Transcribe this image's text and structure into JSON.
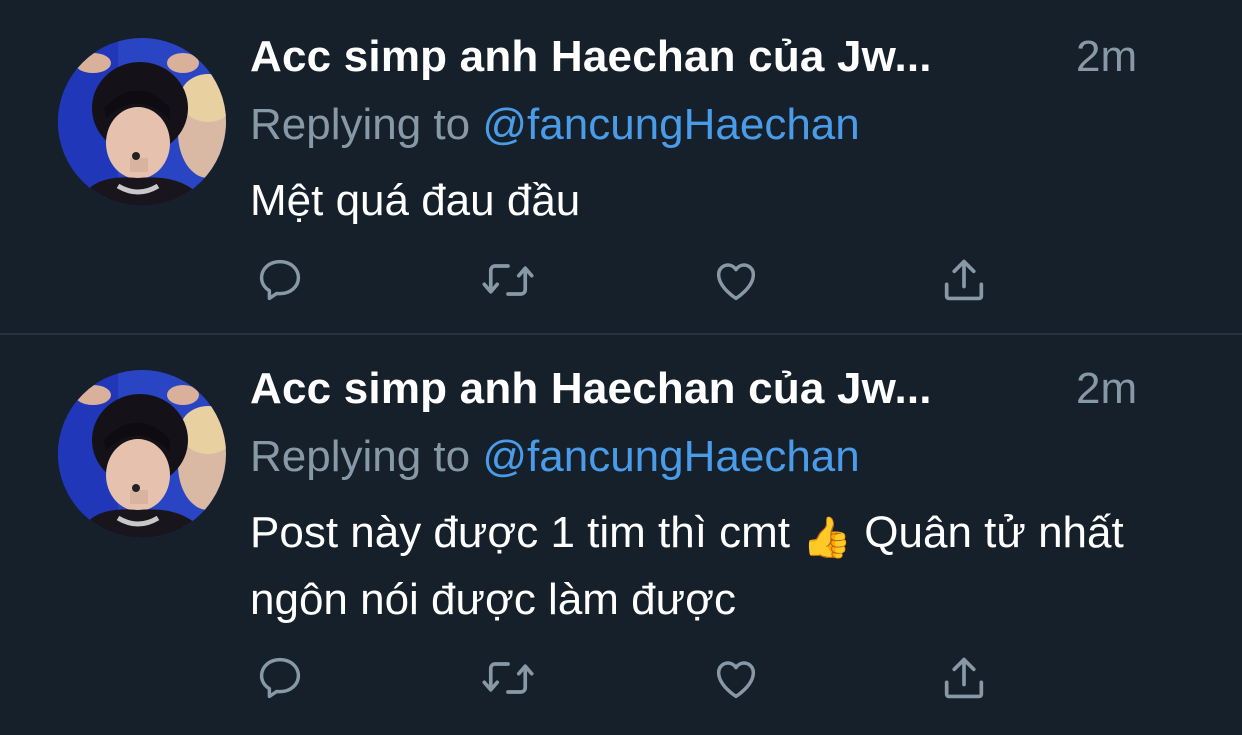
{
  "colors": {
    "background": "#15202b",
    "divider": "#253341",
    "text_primary": "#ffffff",
    "text_secondary": "#8899a6",
    "accent": "#4a9be8"
  },
  "tweets": [
    {
      "display_name": "Acc simp anh Haechan của Jw...",
      "timestamp": "2m",
      "replying_prefix": "Replying to ",
      "replying_handle": "@fancungHaechan",
      "text": "Mệt quá đau đầu",
      "avatar_icon": "profile-photo",
      "actions": [
        "reply-icon",
        "retweet-icon",
        "like-icon",
        "share-icon"
      ]
    },
    {
      "display_name": "Acc simp anh Haechan của Jw...",
      "timestamp": "2m",
      "replying_prefix": "Replying to ",
      "replying_handle": "@fancungHaechan",
      "text_part1": "Post này được 1 tim thì cmt ",
      "emoji": "👍",
      "text_part2": " Quân tử nhất ngôn nói được làm được",
      "avatar_icon": "profile-photo",
      "actions": [
        "reply-icon",
        "retweet-icon",
        "like-icon",
        "share-icon"
      ]
    }
  ]
}
